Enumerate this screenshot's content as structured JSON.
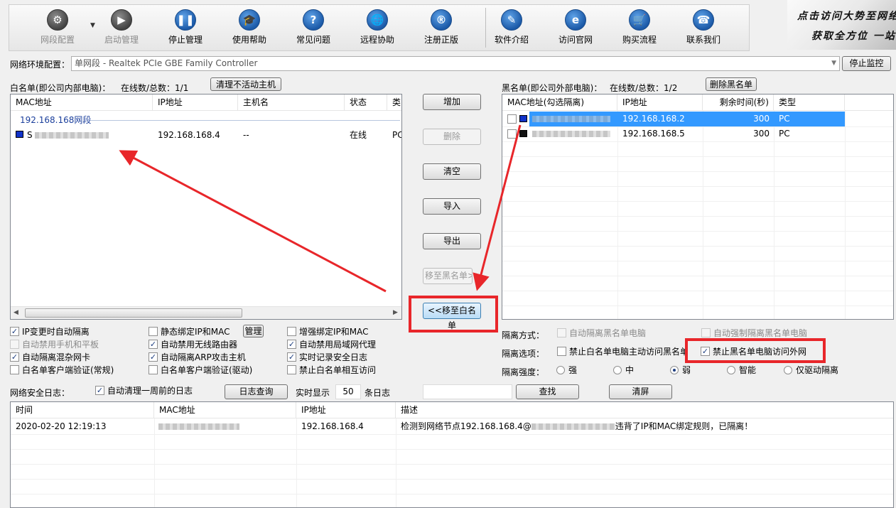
{
  "toolbar": {
    "items": [
      {
        "label": "网段配置",
        "icon": "gear-icon",
        "glyph": "⚙",
        "enabled": false
      },
      {
        "label": "启动管理",
        "icon": "play-icon",
        "glyph": "▶",
        "enabled": false
      },
      {
        "label": "停止管理",
        "icon": "pause-icon",
        "glyph": "❚❚",
        "enabled": true
      },
      {
        "label": "使用帮助",
        "icon": "graduation-cap-icon",
        "glyph": "🎓",
        "enabled": true
      },
      {
        "label": "常见问题",
        "icon": "question-icon",
        "glyph": "?",
        "enabled": true
      },
      {
        "label": "远程协助",
        "icon": "globe-icon",
        "glyph": "🌐",
        "enabled": true
      },
      {
        "label": "注册正版",
        "icon": "registered-icon",
        "glyph": "®",
        "enabled": true
      },
      {
        "label": "软件介绍",
        "icon": "document-icon",
        "glyph": "✎",
        "enabled": true
      },
      {
        "label": "访问官网",
        "icon": "browser-icon",
        "glyph": "e",
        "enabled": true
      },
      {
        "label": "购买流程",
        "icon": "cart-icon",
        "glyph": "🛒",
        "enabled": true
      },
      {
        "label": "联系我们",
        "icon": "phone-icon",
        "glyph": "☎",
        "enabled": true
      }
    ]
  },
  "banner": {
    "line1": "点击访问大势至网络",
    "line2": "获取全方位 一站"
  },
  "network": {
    "label": "网络环境配置：",
    "value": "单网段 - Realtek PCIe GBE Family Controller",
    "stop_monitor": "停止监控"
  },
  "whitelist": {
    "title": "白名单(即公司内部电脑)：",
    "count_label": "在线数/总数：1/1",
    "clear_button": "清理不活动主机",
    "columns": [
      "MAC地址",
      "IP地址",
      "主机名",
      "状态",
      "类"
    ],
    "group": "192.168.168网段",
    "rows": [
      {
        "mac": "S",
        "ip": "192.168.168.4",
        "host": "--",
        "status": "在线",
        "type": "PC"
      }
    ]
  },
  "middle_buttons": {
    "add": "增加",
    "delete": "删除",
    "clear": "清空",
    "import": "导入",
    "export": "导出",
    "to_black": "移至黑名单>>",
    "to_white": "<<移至白名单"
  },
  "blacklist": {
    "title": "黑名单(即公司外部电脑)：",
    "count_label": "在线数/总数：1/2",
    "delete_button": "删除黑名单",
    "columns": [
      "MAC地址(勾选隔离)",
      "IP地址",
      "剩余时间(秒)",
      "类型"
    ],
    "rows": [
      {
        "ip": "192.168.168.2",
        "remaining": "300",
        "type": "PC",
        "selected": true
      },
      {
        "ip": "192.168.168.5",
        "remaining": "300",
        "type": "PC",
        "selected": false
      }
    ]
  },
  "options": {
    "col1": [
      {
        "label": "IP变更时自动隔离",
        "checked": true,
        "enabled": true
      },
      {
        "label": "自动禁用手机和平板",
        "checked": false,
        "enabled": false
      },
      {
        "label": "自动隔离混杂网卡",
        "checked": true,
        "enabled": true
      },
      {
        "label": "白名单客户端验证(常规)",
        "checked": false,
        "enabled": true
      }
    ],
    "col2": [
      {
        "label": "静态绑定IP和MAC",
        "checked": false,
        "enabled": true
      },
      {
        "label": "自动禁用无线路由器",
        "checked": true,
        "enabled": true
      },
      {
        "label": "自动隔离ARP攻击主机",
        "checked": true,
        "enabled": true
      },
      {
        "label": "白名单客户端验证(驱动)",
        "checked": false,
        "enabled": true
      }
    ],
    "manage_button": "管理",
    "col3": [
      {
        "label": "增强绑定IP和MAC",
        "checked": false,
        "enabled": true
      },
      {
        "label": "自动禁用局域网代理",
        "checked": true,
        "enabled": true
      },
      {
        "label": "实时记录安全日志",
        "checked": true,
        "enabled": true
      },
      {
        "label": "禁止白名单相互访问",
        "checked": false,
        "enabled": true
      }
    ]
  },
  "isolation": {
    "method_label": "隔离方式：",
    "method1": "自动隔离黑名单电脑",
    "method2": "自动强制隔离黑名单电脑",
    "options_label": "隔离选项：",
    "opt1": "禁止白名单电脑主动访问黑名单",
    "opt2": "禁止黑名单电脑访问外网",
    "strength_label": "隔离强度：",
    "strengths": [
      "强",
      "中",
      "弱",
      "智能",
      "仅驱动隔离"
    ],
    "selected_strength": "弱"
  },
  "log": {
    "label": "网络安全日志：",
    "auto_clear": "自动清理一周前的日志",
    "query_button": "日志查询",
    "realtime_label": "实时显示",
    "realtime_count": "50",
    "entries_label": "条日志",
    "search_button": "查找",
    "clear_button": "清屏",
    "columns": [
      "时间",
      "MAC地址",
      "IP地址",
      "描述"
    ],
    "rows": [
      {
        "time": "2020-02-20 12:19:13",
        "ip": "192.168.168.4",
        "desc_prefix": "检测到网络节点192.168.168.4@",
        "desc_suffix": "违背了IP和MAC绑定规则，已隔离！"
      }
    ]
  }
}
